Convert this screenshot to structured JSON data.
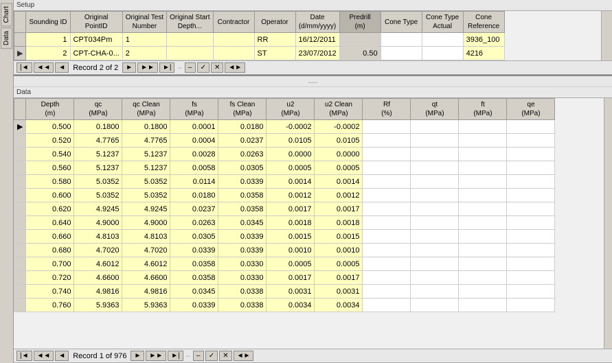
{
  "sidebarTabs": [
    "Chart",
    "Data"
  ],
  "setupSection": {
    "label": "Setup",
    "columns": [
      {
        "id": "sounding-id",
        "label": "Sounding ID"
      },
      {
        "id": "original-point-id",
        "label": "Original PointID"
      },
      {
        "id": "original-test-number",
        "label": "Original Test Number"
      },
      {
        "id": "original-start-depth",
        "label": "Original Start Depth..."
      },
      {
        "id": "contractor",
        "label": "Contractor"
      },
      {
        "id": "operator",
        "label": "Operator"
      },
      {
        "id": "date",
        "label": "Date (d/mm/yyyy)"
      },
      {
        "id": "predrill",
        "label": "Predrill (m)"
      },
      {
        "id": "cone-type",
        "label": "Cone Type"
      },
      {
        "id": "cone-type-actual",
        "label": "Cone Type Actual"
      },
      {
        "id": "cone-reference",
        "label": "Cone Reference"
      }
    ],
    "rows": [
      {
        "indicator": "",
        "soundingId": "1",
        "originalPointId": "CPT034Pm",
        "originalTestNumber": "1",
        "originalStartDepth": "",
        "contractor": "",
        "operator": "RR",
        "date": "16/12/2011",
        "predrill": "",
        "coneType": "",
        "coneTypeActual": "",
        "coneReference": "3936_100"
      },
      {
        "indicator": "▶",
        "soundingId": "2",
        "originalPointId": "CPT-CHA-0...",
        "originalTestNumber": "2",
        "originalStartDepth": "",
        "contractor": "",
        "operator": "ST",
        "date": "23/07/2012",
        "predrill": "0.50",
        "coneType": "",
        "coneTypeActual": "",
        "coneReference": "4216"
      }
    ],
    "navigator": {
      "recordText": "Record 2 of 2"
    }
  },
  "dotsSeparator": ".....",
  "dataSection": {
    "label": "Data",
    "columns": [
      {
        "id": "depth",
        "label": "Depth (m)"
      },
      {
        "id": "qc",
        "label": "qc (MPa)"
      },
      {
        "id": "qc-clean",
        "label": "qc Clean (MPa)"
      },
      {
        "id": "fs",
        "label": "fs (MPa)"
      },
      {
        "id": "fs-clean",
        "label": "fs Clean (MPa)"
      },
      {
        "id": "u2",
        "label": "u2 (MPa)"
      },
      {
        "id": "u2-clean",
        "label": "u2 Clean (MPa)"
      },
      {
        "id": "rf",
        "label": "Rf (%)"
      },
      {
        "id": "qt",
        "label": "qt (MPa)"
      },
      {
        "id": "ft",
        "label": "ft (MPa)"
      },
      {
        "id": "qe",
        "label": "qe (MPa)"
      }
    ],
    "rows": [
      {
        "depth": "0.500",
        "qc": "0.1800",
        "qcClean": "0.1800",
        "fs": "0.0001",
        "fsClean": "0.0180",
        "u2": "-0.0002",
        "u2Clean": "-0.0002",
        "rf": "",
        "qt": "",
        "ft": "",
        "qe": ""
      },
      {
        "depth": "0.520",
        "qc": "4.7765",
        "qcClean": "4.7765",
        "fs": "0.0004",
        "fsClean": "0.0237",
        "u2": "0.0105",
        "u2Clean": "0.0105",
        "rf": "",
        "qt": "",
        "ft": "",
        "qe": ""
      },
      {
        "depth": "0.540",
        "qc": "5.1237",
        "qcClean": "5.1237",
        "fs": "0.0028",
        "fsClean": "0.0263",
        "u2": "0.0000",
        "u2Clean": "0.0000",
        "rf": "",
        "qt": "",
        "ft": "",
        "qe": ""
      },
      {
        "depth": "0.560",
        "qc": "5.1237",
        "qcClean": "5.1237",
        "fs": "0.0058",
        "fsClean": "0.0305",
        "u2": "0.0005",
        "u2Clean": "0.0005",
        "rf": "",
        "qt": "",
        "ft": "",
        "qe": ""
      },
      {
        "depth": "0.580",
        "qc": "5.0352",
        "qcClean": "5.0352",
        "fs": "0.0114",
        "fsClean": "0.0339",
        "u2": "0.0014",
        "u2Clean": "0.0014",
        "rf": "",
        "qt": "",
        "ft": "",
        "qe": ""
      },
      {
        "depth": "0.600",
        "qc": "5.0352",
        "qcClean": "5.0352",
        "fs": "0.0180",
        "fsClean": "0.0358",
        "u2": "0.0012",
        "u2Clean": "0.0012",
        "rf": "",
        "qt": "",
        "ft": "",
        "qe": ""
      },
      {
        "depth": "0.620",
        "qc": "4.9245",
        "qcClean": "4.9245",
        "fs": "0.0237",
        "fsClean": "0.0358",
        "u2": "0.0017",
        "u2Clean": "0.0017",
        "rf": "",
        "qt": "",
        "ft": "",
        "qe": ""
      },
      {
        "depth": "0.640",
        "qc": "4.9000",
        "qcClean": "4.9000",
        "fs": "0.0263",
        "fsClean": "0.0345",
        "u2": "0.0018",
        "u2Clean": "0.0018",
        "rf": "",
        "qt": "",
        "ft": "",
        "qe": ""
      },
      {
        "depth": "0.660",
        "qc": "4.8103",
        "qcClean": "4.8103",
        "fs": "0.0305",
        "fsClean": "0.0339",
        "u2": "0.0015",
        "u2Clean": "0.0015",
        "rf": "",
        "qt": "",
        "ft": "",
        "qe": ""
      },
      {
        "depth": "0.680",
        "qc": "4.7020",
        "qcClean": "4.7020",
        "fs": "0.0339",
        "fsClean": "0.0339",
        "u2": "0.0010",
        "u2Clean": "0.0010",
        "rf": "",
        "qt": "",
        "ft": "",
        "qe": ""
      },
      {
        "depth": "0.700",
        "qc": "4.6012",
        "qcClean": "4.6012",
        "fs": "0.0358",
        "fsClean": "0.0330",
        "u2": "0.0005",
        "u2Clean": "0.0005",
        "rf": "",
        "qt": "",
        "ft": "",
        "qe": ""
      },
      {
        "depth": "0.720",
        "qc": "4.6600",
        "qcClean": "4.6600",
        "fs": "0.0358",
        "fsClean": "0.0330",
        "u2": "0.0017",
        "u2Clean": "0.0017",
        "rf": "",
        "qt": "",
        "ft": "",
        "qe": ""
      },
      {
        "depth": "0.740",
        "qc": "4.9816",
        "qcClean": "4.9816",
        "fs": "0.0345",
        "fsClean": "0.0338",
        "u2": "0.0031",
        "u2Clean": "0.0031",
        "rf": "",
        "qt": "",
        "ft": "",
        "qe": ""
      },
      {
        "depth": "0.760",
        "qc": "5.9363",
        "qcClean": "5.9363",
        "fs": "0.0339",
        "fsClean": "0.0338",
        "u2": "0.0034",
        "u2Clean": "0.0034",
        "rf": "",
        "qt": "",
        "ft": "",
        "qe": ""
      }
    ],
    "navigator": {
      "recordText": "Record 1 of 976"
    }
  },
  "navButtons": {
    "first": "|◄",
    "prevPage": "◄◄",
    "prev": "◄",
    "next": "►",
    "nextPage": "►►",
    "last": "►|",
    "minus": "–",
    "check": "✓",
    "close": "✕",
    "nav": "◄►"
  }
}
